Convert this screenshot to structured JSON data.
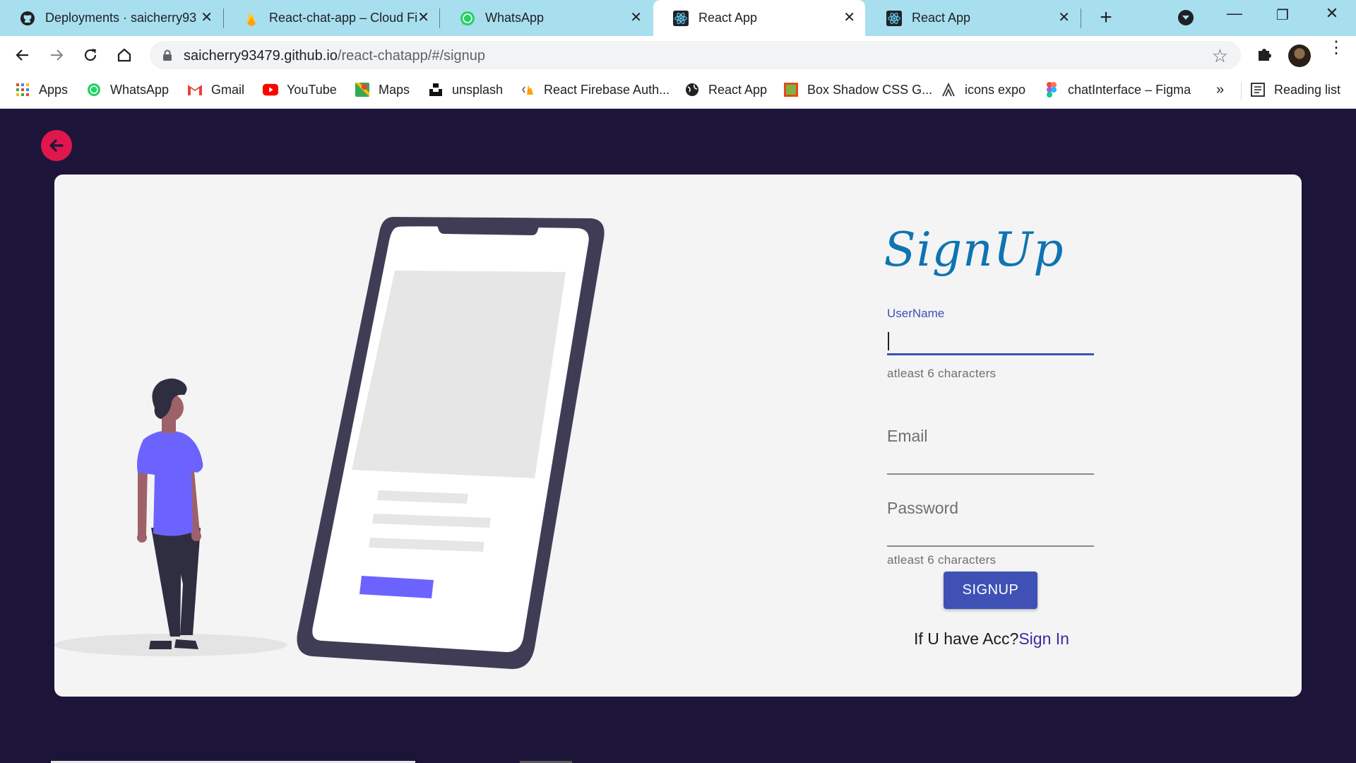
{
  "browser": {
    "tabs": [
      {
        "title": "Deployments · saicherry93",
        "icon": "github-icon",
        "active": false
      },
      {
        "title": "React-chat-app – Cloud Fi",
        "icon": "firebase-icon",
        "active": false
      },
      {
        "title": "WhatsApp",
        "icon": "whatsapp-icon",
        "active": false
      },
      {
        "title": "React App",
        "icon": "react-icon",
        "active": true
      },
      {
        "title": "React App",
        "icon": "react-icon",
        "active": false
      }
    ],
    "url_host": "saicherry93479.github.io",
    "url_path": "/react-chatapp/#/signup",
    "bookmarks": [
      {
        "label": "Apps",
        "icon": "apps-grid-icon"
      },
      {
        "label": "WhatsApp",
        "icon": "whatsapp-icon"
      },
      {
        "label": "Gmail",
        "icon": "gmail-icon"
      },
      {
        "label": "YouTube",
        "icon": "youtube-icon"
      },
      {
        "label": "Maps",
        "icon": "maps-icon"
      },
      {
        "label": "unsplash",
        "icon": "unsplash-icon"
      },
      {
        "label": "React Firebase Auth...",
        "icon": "firebase-auth-icon"
      },
      {
        "label": "React App",
        "icon": "globe-icon"
      },
      {
        "label": "Box Shadow CSS G...",
        "icon": "box-shadow-icon"
      },
      {
        "label": "icons expo",
        "icon": "expo-icon"
      },
      {
        "label": "chatInterface – Figma",
        "icon": "figma-icon"
      }
    ],
    "bookmarks_more": "»",
    "reading_list": "Reading list",
    "colors": {
      "tabstrip": "#a8dfef",
      "page_bg": "#1d1539"
    }
  },
  "page": {
    "title": "SignUp",
    "username": {
      "label": "UserName",
      "value": "",
      "helper": "atleast 6 characters"
    },
    "email": {
      "label": "Email",
      "value": ""
    },
    "password": {
      "label": "Password",
      "value": "",
      "helper": "atleast 6 characters"
    },
    "signup_button": "SIGNUP",
    "have_account_text": "If U have Acc?",
    "signin_link": "Sign In",
    "colors": {
      "primary": "#3f51b5",
      "back_button": "#e0164d",
      "title": "#0e74b3",
      "card": "#f4f4f4"
    }
  }
}
